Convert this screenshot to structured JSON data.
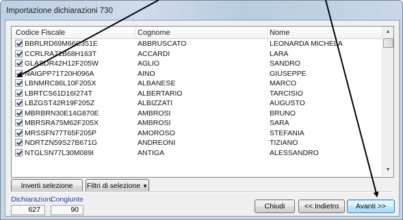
{
  "window": {
    "title": "Importazione dichiarazioni 730"
  },
  "list": {
    "columns": [
      "Codice Fiscale",
      "Cognome",
      "Nome"
    ],
    "rows": [
      {
        "cf": "BBRLRD69M66C351E",
        "cognome": "ABBRUSCATO",
        "nome": "LEONARDA MICHELA",
        "checked": true
      },
      {
        "cf": "CCRLRA71B68H163T",
        "cognome": "ACCARDI",
        "nome": "LARA",
        "checked": true
      },
      {
        "cf": "GLASDR42H12F205W",
        "cognome": "AGLIO",
        "nome": "SANDRO",
        "checked": true
      },
      {
        "cf": "NAIGPP71T20H096A",
        "cognome": "AINO",
        "nome": "GIUSEPPE",
        "checked": true
      },
      {
        "cf": "LBNMRC86L10F205X",
        "cognome": "ALBANESE",
        "nome": "MARCO",
        "checked": true
      },
      {
        "cf": "LBRTCS61D16I274T",
        "cognome": "ALBERTARIO",
        "nome": "TARCISIO",
        "checked": true
      },
      {
        "cf": "LBZGST42R19F205Z",
        "cognome": "ALBIZZATI",
        "nome": "AUGUSTO",
        "checked": true
      },
      {
        "cf": "MBRBRN30E14G870E",
        "cognome": "AMBROSI",
        "nome": "BRUNO",
        "checked": true
      },
      {
        "cf": "MBRSRA75M62F205X",
        "cognome": "AMBROSI",
        "nome": "SARA",
        "checked": true
      },
      {
        "cf": "MRSSFN77T65F205P",
        "cognome": "AMOROSO",
        "nome": "STEFANIA",
        "checked": true
      },
      {
        "cf": "NDRTZN59S27B671G",
        "cognome": "ANDREONI",
        "nome": "TIZIANO",
        "checked": true
      },
      {
        "cf": "NTGLSN77L30M089I",
        "cognome": "ANTIGA",
        "nome": "ALESSANDRO",
        "checked": true
      }
    ]
  },
  "actions": {
    "invert_label": "Inverti selezione",
    "filter_label": "Filtri di selezione"
  },
  "stats": {
    "dichiarazioni_label": "Dichiarazioni",
    "dichiarazioni_value": "627",
    "congiunte_label": "Congiunte",
    "congiunte_value": "90"
  },
  "footer": {
    "close_label": "Chiudi",
    "back_label": "<< Indietro",
    "next_label": "Avanti >>"
  },
  "colors": {
    "annotation_arrow": "#000000",
    "stat_label": "#1a3ea3"
  }
}
